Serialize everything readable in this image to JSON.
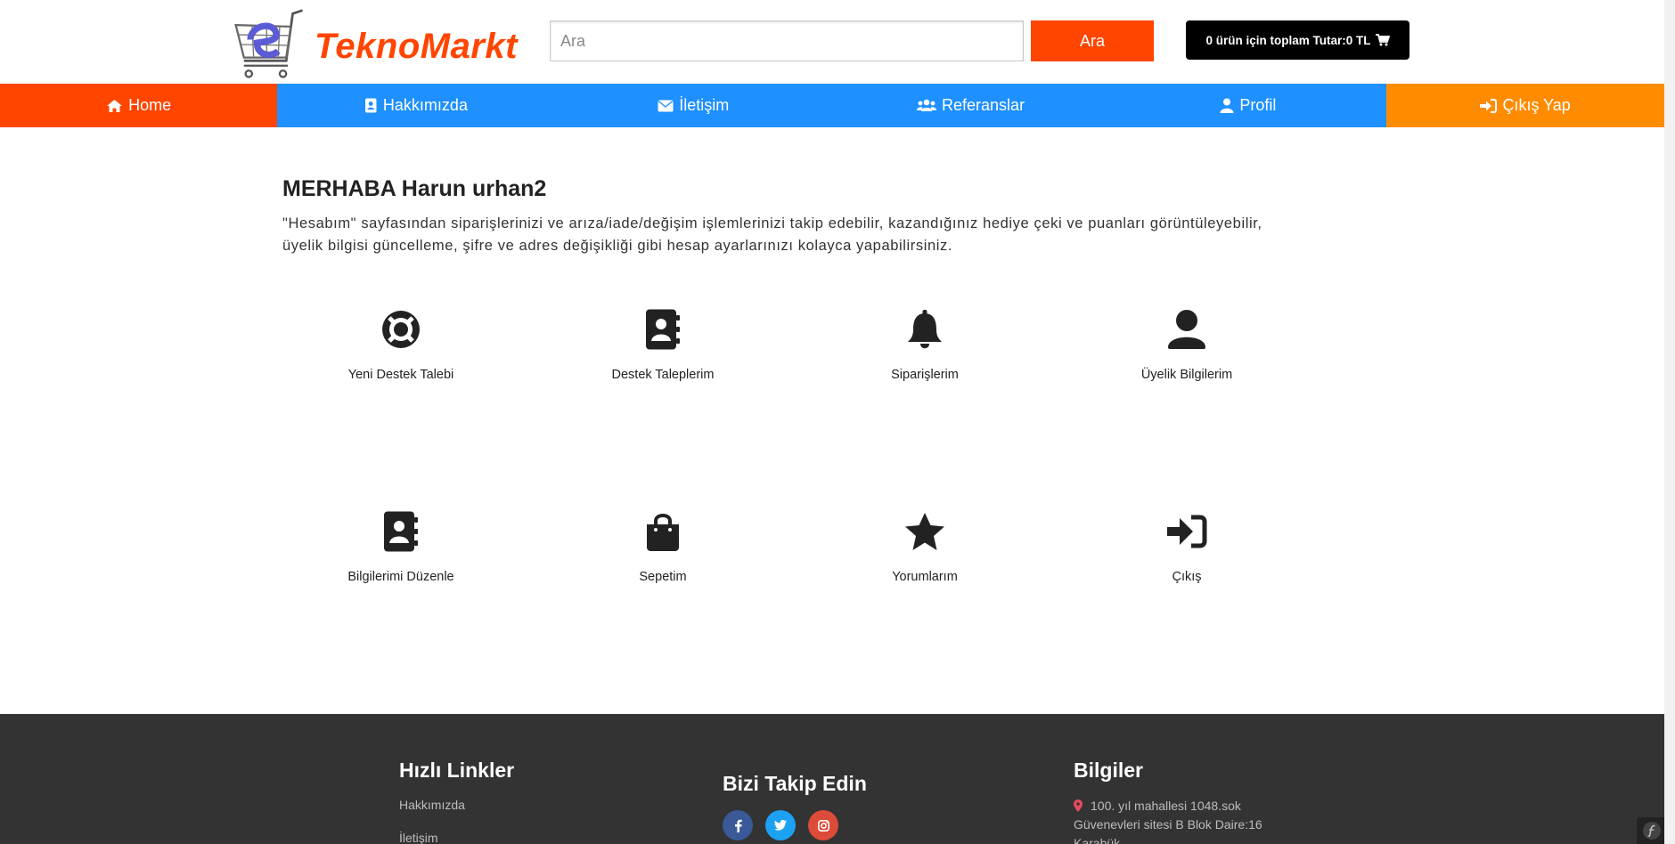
{
  "brand": {
    "name": "TeknoMarkt",
    "color": "#ff4500"
  },
  "search": {
    "placeholder": "Ara",
    "button_label": "Ara"
  },
  "cart": {
    "label": "0 ürün için toplam Tutar:0 TL",
    "icon": "shopping-cart-icon"
  },
  "nav": [
    {
      "label": "Home",
      "icon": "home-icon",
      "color": "#ff4500"
    },
    {
      "label": "Hakkımızda",
      "icon": "address-book-icon",
      "color": "#1e90ff"
    },
    {
      "label": "İletişim",
      "icon": "envelope-icon",
      "color": "#1e90ff"
    },
    {
      "label": "Referanslar",
      "icon": "users-icon",
      "color": "#1e90ff"
    },
    {
      "label": "Profil",
      "icon": "user-icon",
      "color": "#1e90ff"
    },
    {
      "label": "Çıkış Yap",
      "icon": "sign-in-icon",
      "color": "#ff8c00"
    }
  ],
  "welcome": {
    "title": "MERHABA Harun urhan2",
    "text_line1": "\"Hesabım\" sayfasından siparişlerinizi ve arıza/iade/değişim işlemlerinizi takip edebilir, kazandığınız hediye çeki ve puanları görüntüleyebilir,",
    "text_line2": "üyelik bilgisi güncelleme, şifre ve adres değişikliği gibi hesap ayarlarınızı kolayca yapabilirsiniz."
  },
  "tiles": [
    {
      "label": "Yeni Destek Talebi",
      "icon": "life-ring-icon"
    },
    {
      "label": "Destek Taleplerim",
      "icon": "address-book-icon"
    },
    {
      "label": "Siparişlerim",
      "icon": "bell-icon"
    },
    {
      "label": "Üyelik Bilgilerim",
      "icon": "user-icon"
    },
    {
      "label": "Bilgilerimi Düzenle",
      "icon": "address-book-icon"
    },
    {
      "label": "Sepetim",
      "icon": "shopping-bag-icon"
    },
    {
      "label": "Yorumlarım",
      "icon": "star-icon"
    },
    {
      "label": "Çıkış",
      "icon": "sign-in-icon"
    }
  ],
  "footer": {
    "quick_links": {
      "title": "Hızlı Linkler",
      "items": [
        "Hakkımızda",
        "İletişim"
      ]
    },
    "follow": {
      "title": "Bizi Takip Edin",
      "facebook_color": "#3b5998",
      "twitter_color": "#1da1f2",
      "instagram_color": "#dd4b39"
    },
    "info": {
      "title": "Bilgiler",
      "address_line1": "100. yıl mahallesi 1048.sok",
      "address_line2": "Güvenevleri sitesi B Blok Daire:16",
      "address_line3": "Karabük"
    }
  }
}
